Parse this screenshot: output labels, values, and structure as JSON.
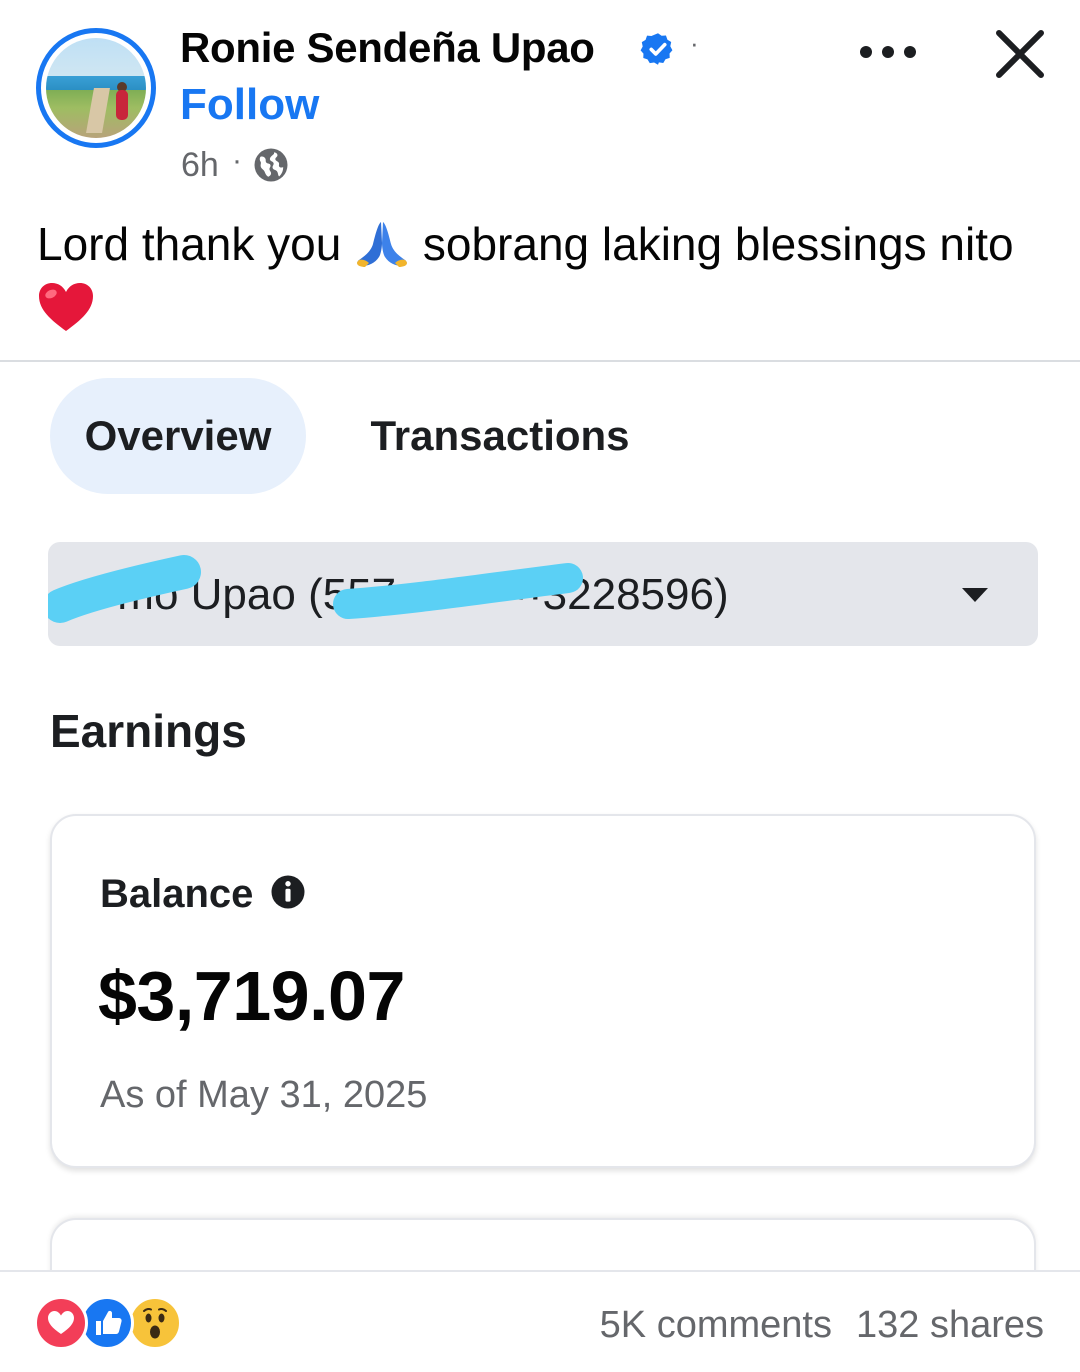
{
  "post": {
    "author": "Ronie Sendeña Upao",
    "follow_label": "Follow",
    "time": "6h",
    "separator": "·",
    "caption_part1": "Lord thank you",
    "caption_part2": "sobrang laking blessings nito",
    "icons": {
      "verified": "verified-badge-icon",
      "globe": "globe-icon",
      "more": "more-options-icon",
      "close": "close-icon"
    }
  },
  "monetization": {
    "tabs": [
      {
        "label": "Overview",
        "active": true
      },
      {
        "label": "Transactions",
        "active": false
      }
    ],
    "account_selector": "Donnio Upao (557100000003228596)",
    "account_selector_visible": "··mo Upao (557··········3228596)",
    "section_title": "Earnings",
    "balance": {
      "label": "Balance",
      "value": "$3,719.07",
      "as_of": "As of May 31, 2025"
    }
  },
  "footer": {
    "reactions": [
      "love",
      "like",
      "wow"
    ],
    "comments": "5K comments",
    "shares": "132 shares"
  },
  "colors": {
    "brand_blue": "#1877f2",
    "secondary_text": "#65676b",
    "tab_active_bg": "#e7f0fc",
    "select_bg": "#e4e6eb",
    "redaction_scribble": "#5bd0f5"
  }
}
